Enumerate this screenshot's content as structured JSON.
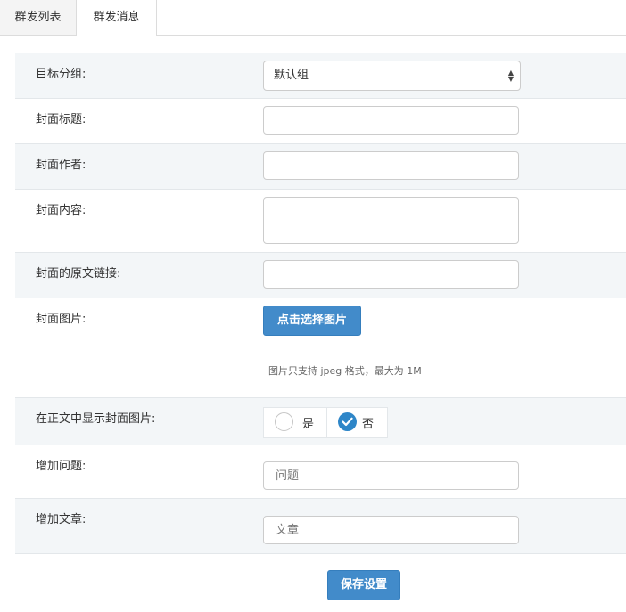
{
  "tabs": [
    {
      "label": "群发列表"
    },
    {
      "label": "群发消息"
    }
  ],
  "form": {
    "target_group": {
      "label": "目标分组:",
      "value": "默认组"
    },
    "cover_title": {
      "label": "封面标题:",
      "value": ""
    },
    "cover_author": {
      "label": "封面作者:",
      "value": ""
    },
    "cover_content": {
      "label": "封面内容:",
      "value": ""
    },
    "cover_link": {
      "label": "封面的原文链接:",
      "value": ""
    },
    "cover_image": {
      "label": "封面图片:",
      "button_label": "点击选择图片",
      "help_text": "图片只支持 jpeg 格式，最大为 1M"
    },
    "show_cover": {
      "label": "在正文中显示封面图片:",
      "options": [
        {
          "label": "是",
          "selected": false
        },
        {
          "label": "否",
          "selected": true
        }
      ]
    },
    "add_question": {
      "label": "增加问题:",
      "placeholder": "问题"
    },
    "add_article": {
      "label": "增加文章:",
      "placeholder": "文章"
    }
  },
  "save_button": {
    "label": "保存设置"
  },
  "colors": {
    "primary": "#428bca",
    "checked": "#2e86c8",
    "row_alt": "#f3f6f8"
  }
}
